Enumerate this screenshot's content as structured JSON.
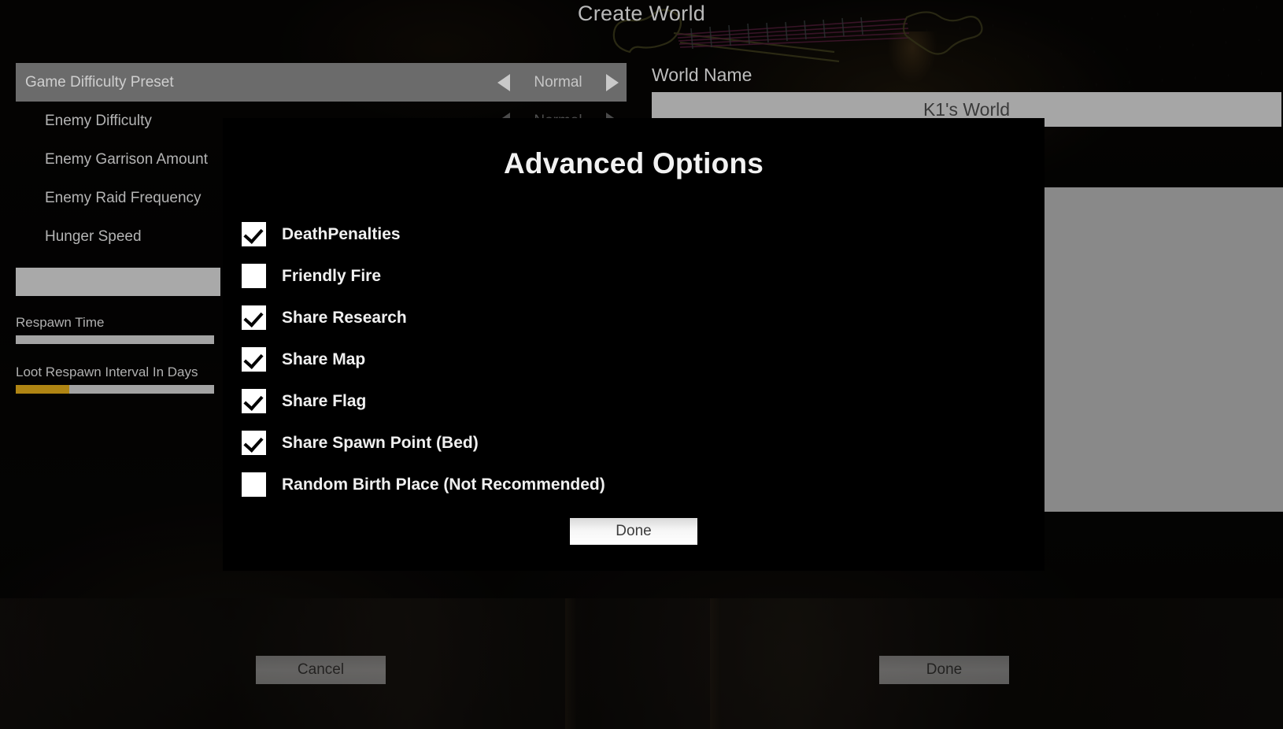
{
  "header": {
    "title": "Create World"
  },
  "settings": [
    {
      "label": "Game Difficulty Preset",
      "value": "Normal",
      "selected": true
    },
    {
      "label": "Enemy Difficulty",
      "value": "Normal",
      "selected": false
    },
    {
      "label": "Enemy Garrison Amount",
      "value": "",
      "selected": false
    },
    {
      "label": "Enemy Raid Frequency",
      "value": "",
      "selected": false
    },
    {
      "label": "Hunger Speed",
      "value": "",
      "selected": false
    }
  ],
  "sliders": [
    {
      "label": "Respawn Time",
      "fill_percent": 0
    },
    {
      "label": "Loot Respawn Interval In Days",
      "fill_percent": 27
    }
  ],
  "world": {
    "name_label": "World Name",
    "name_value": "K1's World"
  },
  "dialog": {
    "title": "Advanced Options",
    "done_label": "Done",
    "options": [
      {
        "label": "DeathPenalties",
        "checked": true
      },
      {
        "label": "Friendly Fire",
        "checked": false
      },
      {
        "label": "Share Research",
        "checked": true
      },
      {
        "label": "Share Map",
        "checked": true
      },
      {
        "label": "Share Flag",
        "checked": true
      },
      {
        "label": "Share Spawn Point (Bed)",
        "checked": true
      },
      {
        "label": "Random Birth Place (Not Recommended)",
        "checked": false
      }
    ]
  },
  "footer": {
    "cancel_label": "Cancel",
    "done_label": "Done"
  },
  "colors": {
    "dialog_background": "#000000",
    "selected_row": "#6b6b6b",
    "slider_fill": "#b08513",
    "slider_track": "#a3a3a3",
    "input_background": "#a6a6a6",
    "preview_panel": "#898989",
    "checkbox": "#ffffff"
  }
}
